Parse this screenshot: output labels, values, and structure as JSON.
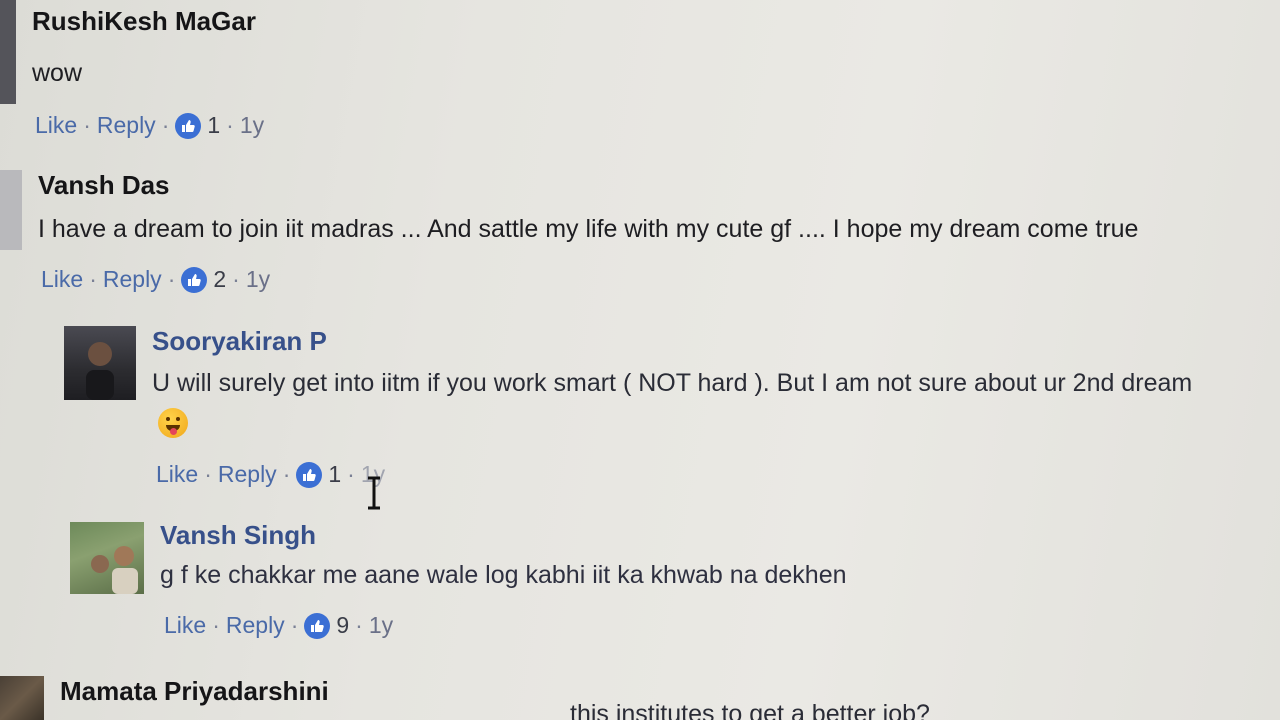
{
  "colors": {
    "link": "#4a6aa8",
    "author_blue": "#37508a",
    "like_badge": "#3b6fd4"
  },
  "comments": [
    {
      "author": "RushiKesh MaGar",
      "text": "wow",
      "like_label": "Like",
      "reply_label": "Reply",
      "reactions": "1",
      "time": "1y"
    },
    {
      "author": "Vansh Das",
      "text": "I have a dream to join iit madras ... And sattle my life with my cute gf .... I hope my dream come true",
      "like_label": "Like",
      "reply_label": "Reply",
      "reactions": "2",
      "time": "1y"
    }
  ],
  "replies": [
    {
      "author": "Sooryakiran P",
      "text": "U will surely get into iitm if you work smart ( NOT hard ). But I am not sure about ur 2nd dream",
      "emoji": "tongue-out-emoji",
      "like_label": "Like",
      "reply_label": "Reply",
      "reactions": "1",
      "time": "1y"
    },
    {
      "author": "Vansh Singh",
      "text": "g f ke chakkar me aane wale log kabhi iit ka khwab na dekhen",
      "like_label": "Like",
      "reply_label": "Reply",
      "reactions": "9",
      "time": "1y"
    }
  ],
  "next_comment": {
    "author": "Mamata Priyadarshini",
    "text_partial": "this institutes to get a better job?"
  }
}
